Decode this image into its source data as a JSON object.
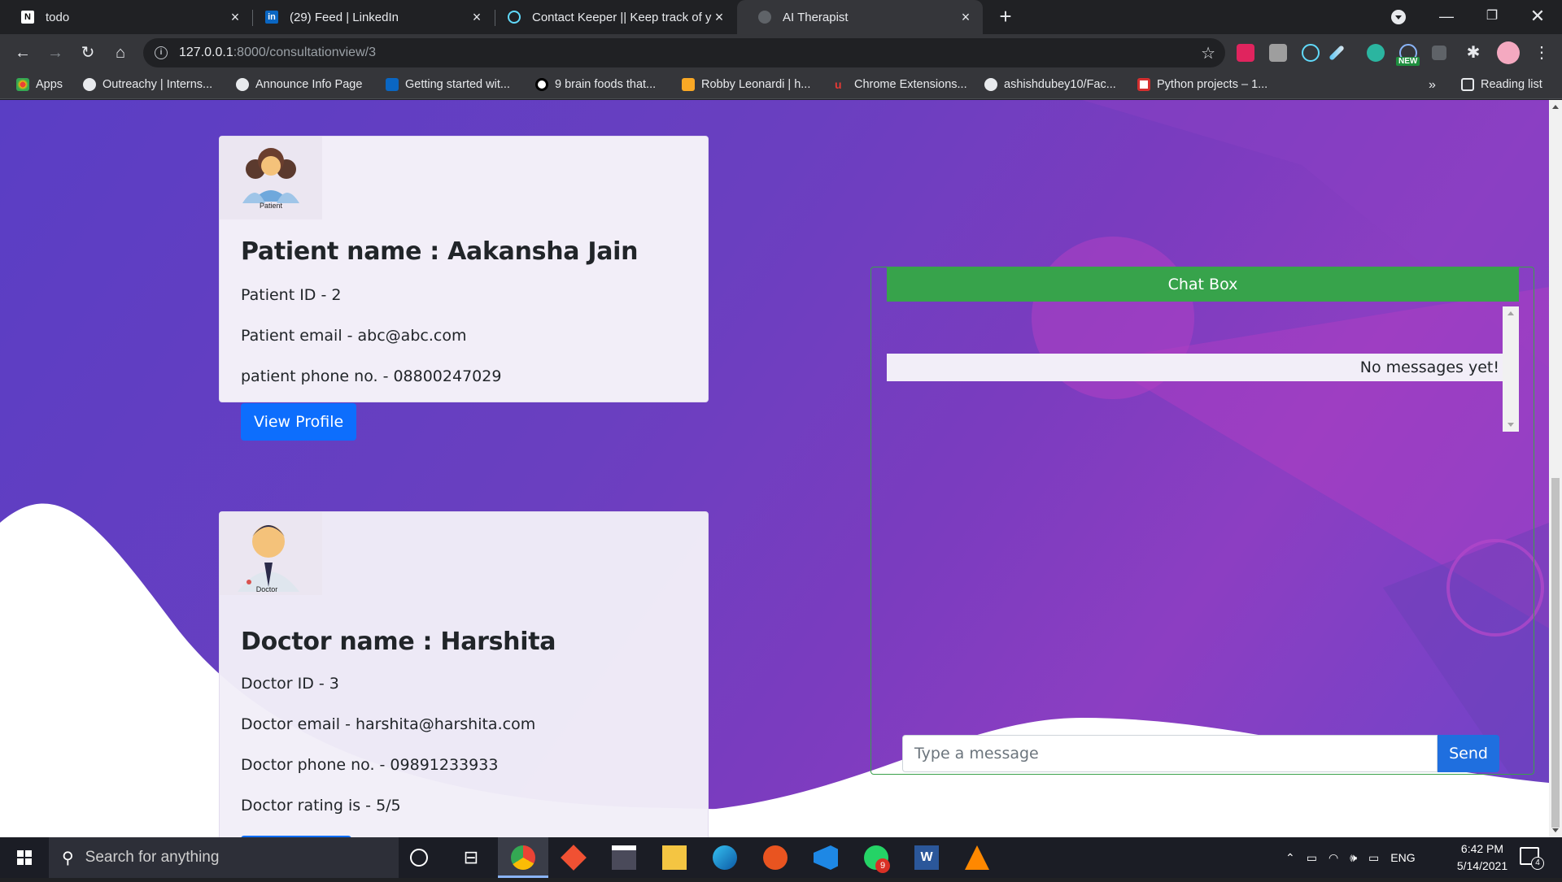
{
  "browser": {
    "tabs": [
      {
        "title": "todo",
        "active": false,
        "icon": "notion-icon"
      },
      {
        "title": "(29) Feed | LinkedIn",
        "active": false,
        "icon": "linkedin-icon"
      },
      {
        "title": "Contact Keeper || Keep track of y",
        "active": false,
        "icon": "react-icon"
      },
      {
        "title": "AI Therapist",
        "active": true,
        "icon": "globe-icon"
      }
    ],
    "url_host": "127.0.0.1",
    "url_rest": ":8000/consultationview/3",
    "ext_badge": "NEW",
    "bookmarks": [
      "Apps",
      "Outreachy | Interns...",
      "Announce Info Page",
      "Getting started wit...",
      "9 brain foods that...",
      "Robby Leonardi | h...",
      "Chrome Extensions...",
      "ashishdubey10/Fac...",
      "Python projects – 1..."
    ],
    "more_bookmarks": "»",
    "reading_list": "Reading list"
  },
  "patient": {
    "avatar_caption": "Patient",
    "name": "Patient name : Aakansha Jain",
    "id": "Patient ID - 2",
    "email": "Patient email - abc@abc.com",
    "phone": "patient phone no. - 08800247029",
    "button": "View Profile"
  },
  "doctor": {
    "avatar_caption": "Doctor",
    "name": "Doctor name : Harshita",
    "id": "Doctor ID - 3",
    "email": "Doctor email - harshita@harshita.com",
    "phone": "Doctor phone no. - 09891233933",
    "rating": "Doctor rating is - 5/5"
  },
  "chat": {
    "title": "Chat Box",
    "empty_text": "No messages yet!",
    "input_placeholder": "Type a message",
    "send_label": "Send"
  },
  "taskbar": {
    "search_placeholder": "Search for anything",
    "whatsapp_badge": "9",
    "language": "ENG",
    "time": "6:42 PM",
    "date": "5/14/2021",
    "notification_count": "4"
  },
  "colors": {
    "primary": "#0d6efd",
    "chat_header": "#37a34b",
    "page_bg": "#6a3fc0"
  }
}
